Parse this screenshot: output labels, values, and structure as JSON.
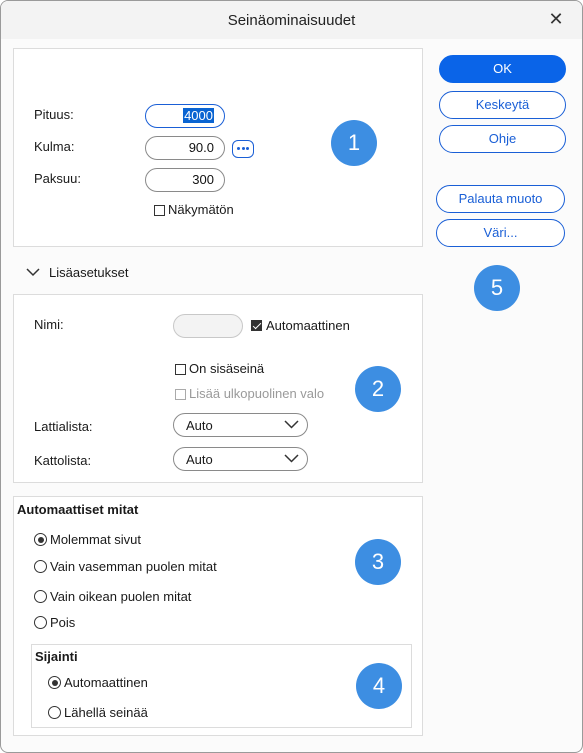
{
  "window": {
    "title": "Seinäominaisuudet",
    "close_glyph": "✕"
  },
  "geometry_panel": {
    "length_label": "Pituus:",
    "length_value": "4000",
    "angle_label": "Kulma:",
    "angle_value": "90.0",
    "thickness_label": "Paksuu:",
    "thickness_value": "300",
    "invisible_label": "Näkymätön"
  },
  "advanced": {
    "header": "Lisäasetukset",
    "name_label": "Nimi:",
    "name_value": "",
    "auto_label": "Automaattinen",
    "auto_checked": true,
    "inner_wall_label": "On sisäseinä",
    "outdoor_light_label": "Lisää ulkopuolinen valo",
    "floor_trim_label": "Lattialista:",
    "floor_trim_value": "Auto",
    "ceiling_trim_label": "Kattolista:",
    "ceiling_trim_value": "Auto"
  },
  "auto_dimensions": {
    "header": "Automaattiset mitat",
    "options": [
      "Molemmat sivut",
      "Vain vasemman puolen mitat",
      "Vain oikean puolen mitat",
      "Pois"
    ],
    "selected": 0,
    "location": {
      "header": "Sijainti",
      "options": [
        "Automaattinen",
        "Lähellä seinää"
      ],
      "selected": 0
    }
  },
  "buttons": {
    "ok": "OK",
    "cancel": "Keskeytä",
    "help": "Ohje",
    "reset_shape": "Palauta muoto",
    "color": "Väri..."
  },
  "badges": [
    "1",
    "2",
    "3",
    "4",
    "5"
  ],
  "colors": {
    "accent": "#0a64e8",
    "badge": "#3d8ee2"
  }
}
